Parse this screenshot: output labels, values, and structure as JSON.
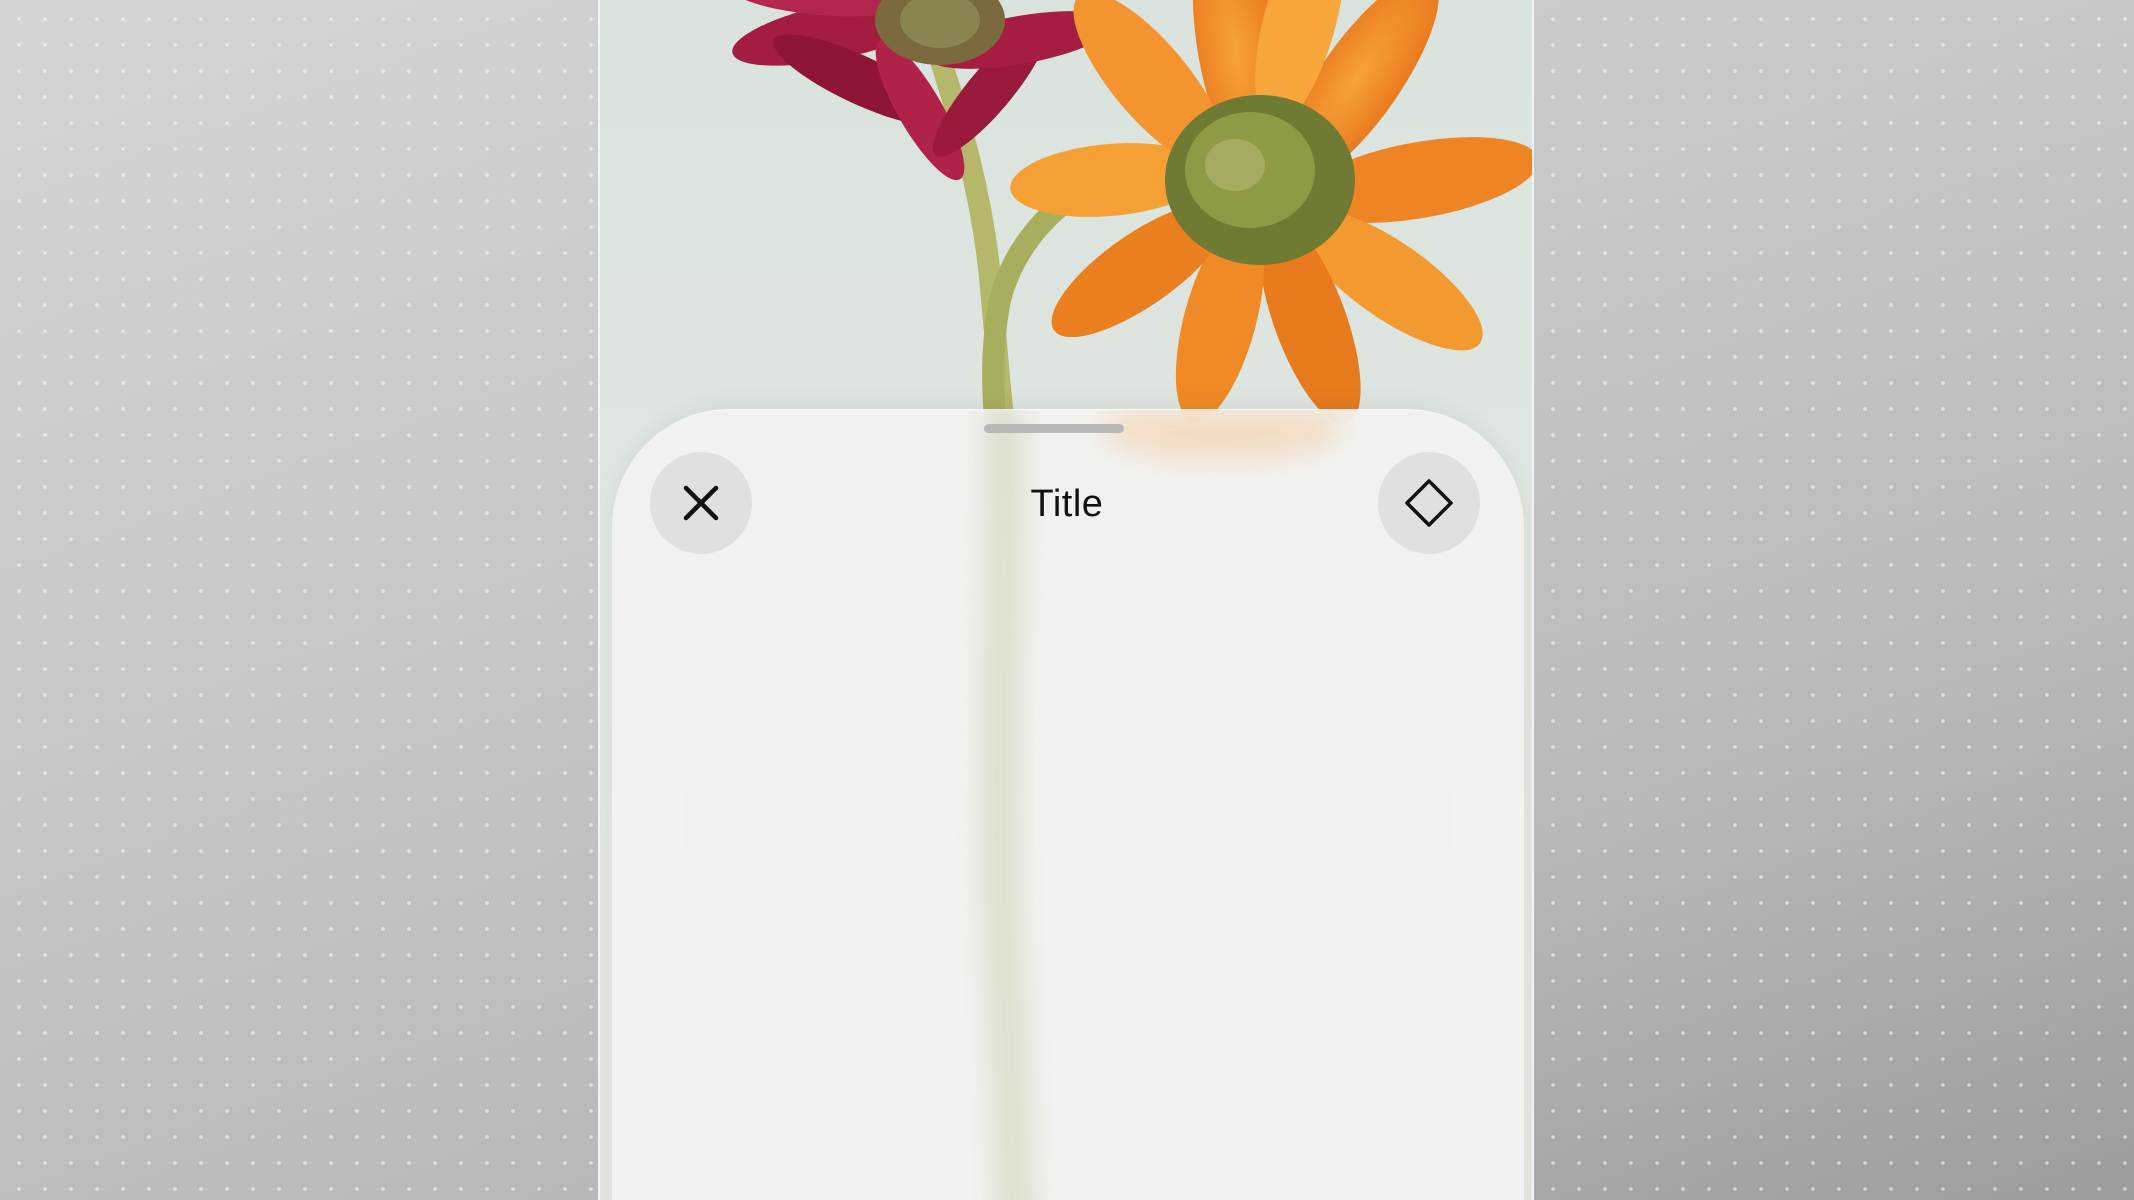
{
  "sheet": {
    "title": "Title",
    "close_icon": "xmark-icon",
    "action_icon": "diamond-icon"
  },
  "background": {
    "image_subject": "gerbera-daisies-photo"
  },
  "colors": {
    "sheet": "#f3f3f1",
    "button": "#dedede",
    "flower_red": "#9c1a3a",
    "flower_orange": "#f08a24"
  }
}
